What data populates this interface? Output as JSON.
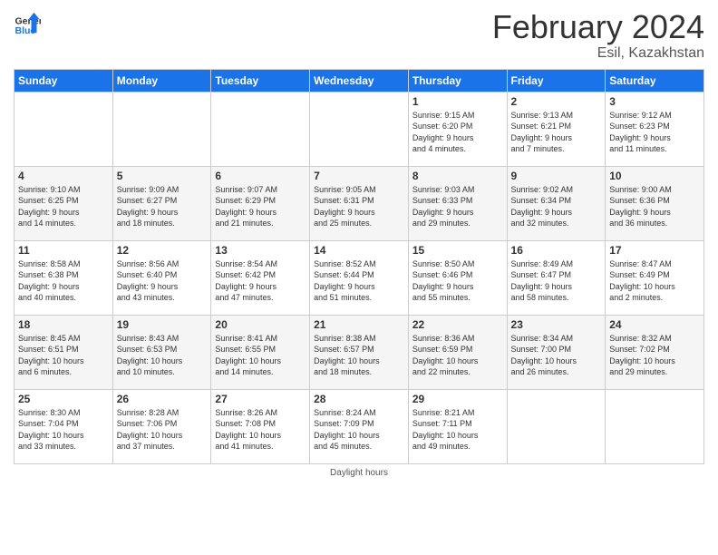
{
  "header": {
    "logo_line1": "General",
    "logo_line2": "Blue",
    "month_year": "February 2024",
    "location": "Esil, Kazakhstan"
  },
  "days_of_week": [
    "Sunday",
    "Monday",
    "Tuesday",
    "Wednesday",
    "Thursday",
    "Friday",
    "Saturday"
  ],
  "weeks": [
    [
      {
        "num": "",
        "info": ""
      },
      {
        "num": "",
        "info": ""
      },
      {
        "num": "",
        "info": ""
      },
      {
        "num": "",
        "info": ""
      },
      {
        "num": "1",
        "info": "Sunrise: 9:15 AM\nSunset: 6:20 PM\nDaylight: 9 hours\nand 4 minutes."
      },
      {
        "num": "2",
        "info": "Sunrise: 9:13 AM\nSunset: 6:21 PM\nDaylight: 9 hours\nand 7 minutes."
      },
      {
        "num": "3",
        "info": "Sunrise: 9:12 AM\nSunset: 6:23 PM\nDaylight: 9 hours\nand 11 minutes."
      }
    ],
    [
      {
        "num": "4",
        "info": "Sunrise: 9:10 AM\nSunset: 6:25 PM\nDaylight: 9 hours\nand 14 minutes."
      },
      {
        "num": "5",
        "info": "Sunrise: 9:09 AM\nSunset: 6:27 PM\nDaylight: 9 hours\nand 18 minutes."
      },
      {
        "num": "6",
        "info": "Sunrise: 9:07 AM\nSunset: 6:29 PM\nDaylight: 9 hours\nand 21 minutes."
      },
      {
        "num": "7",
        "info": "Sunrise: 9:05 AM\nSunset: 6:31 PM\nDaylight: 9 hours\nand 25 minutes."
      },
      {
        "num": "8",
        "info": "Sunrise: 9:03 AM\nSunset: 6:33 PM\nDaylight: 9 hours\nand 29 minutes."
      },
      {
        "num": "9",
        "info": "Sunrise: 9:02 AM\nSunset: 6:34 PM\nDaylight: 9 hours\nand 32 minutes."
      },
      {
        "num": "10",
        "info": "Sunrise: 9:00 AM\nSunset: 6:36 PM\nDaylight: 9 hours\nand 36 minutes."
      }
    ],
    [
      {
        "num": "11",
        "info": "Sunrise: 8:58 AM\nSunset: 6:38 PM\nDaylight: 9 hours\nand 40 minutes."
      },
      {
        "num": "12",
        "info": "Sunrise: 8:56 AM\nSunset: 6:40 PM\nDaylight: 9 hours\nand 43 minutes."
      },
      {
        "num": "13",
        "info": "Sunrise: 8:54 AM\nSunset: 6:42 PM\nDaylight: 9 hours\nand 47 minutes."
      },
      {
        "num": "14",
        "info": "Sunrise: 8:52 AM\nSunset: 6:44 PM\nDaylight: 9 hours\nand 51 minutes."
      },
      {
        "num": "15",
        "info": "Sunrise: 8:50 AM\nSunset: 6:46 PM\nDaylight: 9 hours\nand 55 minutes."
      },
      {
        "num": "16",
        "info": "Sunrise: 8:49 AM\nSunset: 6:47 PM\nDaylight: 9 hours\nand 58 minutes."
      },
      {
        "num": "17",
        "info": "Sunrise: 8:47 AM\nSunset: 6:49 PM\nDaylight: 10 hours\nand 2 minutes."
      }
    ],
    [
      {
        "num": "18",
        "info": "Sunrise: 8:45 AM\nSunset: 6:51 PM\nDaylight: 10 hours\nand 6 minutes."
      },
      {
        "num": "19",
        "info": "Sunrise: 8:43 AM\nSunset: 6:53 PM\nDaylight: 10 hours\nand 10 minutes."
      },
      {
        "num": "20",
        "info": "Sunrise: 8:41 AM\nSunset: 6:55 PM\nDaylight: 10 hours\nand 14 minutes."
      },
      {
        "num": "21",
        "info": "Sunrise: 8:38 AM\nSunset: 6:57 PM\nDaylight: 10 hours\nand 18 minutes."
      },
      {
        "num": "22",
        "info": "Sunrise: 8:36 AM\nSunset: 6:59 PM\nDaylight: 10 hours\nand 22 minutes."
      },
      {
        "num": "23",
        "info": "Sunrise: 8:34 AM\nSunset: 7:00 PM\nDaylight: 10 hours\nand 26 minutes."
      },
      {
        "num": "24",
        "info": "Sunrise: 8:32 AM\nSunset: 7:02 PM\nDaylight: 10 hours\nand 29 minutes."
      }
    ],
    [
      {
        "num": "25",
        "info": "Sunrise: 8:30 AM\nSunset: 7:04 PM\nDaylight: 10 hours\nand 33 minutes."
      },
      {
        "num": "26",
        "info": "Sunrise: 8:28 AM\nSunset: 7:06 PM\nDaylight: 10 hours\nand 37 minutes."
      },
      {
        "num": "27",
        "info": "Sunrise: 8:26 AM\nSunset: 7:08 PM\nDaylight: 10 hours\nand 41 minutes."
      },
      {
        "num": "28",
        "info": "Sunrise: 8:24 AM\nSunset: 7:09 PM\nDaylight: 10 hours\nand 45 minutes."
      },
      {
        "num": "29",
        "info": "Sunrise: 8:21 AM\nSunset: 7:11 PM\nDaylight: 10 hours\nand 49 minutes."
      },
      {
        "num": "",
        "info": ""
      },
      {
        "num": "",
        "info": ""
      }
    ]
  ],
  "footer": {
    "daylight_label": "Daylight hours"
  }
}
